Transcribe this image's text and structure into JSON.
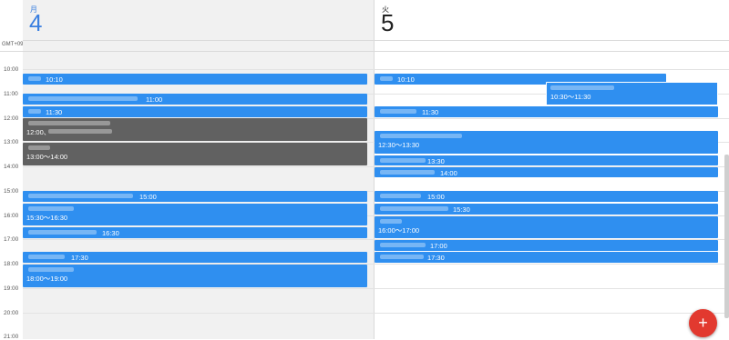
{
  "timezone": "GMT+09",
  "days": [
    {
      "dow": "月",
      "date": "4"
    },
    {
      "dow": "火",
      "date": "5"
    }
  ],
  "hours": [
    "10:00",
    "11:00",
    "12:00",
    "13:00",
    "14:00",
    "15:00",
    "16:00",
    "17:00",
    "18:00",
    "19:00",
    "20:00",
    "21:00"
  ],
  "monday_events": [
    {
      "time": "10:10"
    },
    {
      "time": "11:00"
    },
    {
      "time": "11:30"
    },
    {
      "time": "12:00、"
    },
    {
      "time": "13:00～14:00"
    },
    {
      "time": "15:00"
    },
    {
      "time": "15:30～16:30"
    },
    {
      "time": "16:30"
    },
    {
      "time": "17:30"
    },
    {
      "time": "18:00～19:00"
    }
  ],
  "tuesday_events": [
    {
      "time": "10:10"
    },
    {
      "time": "10:30～11:30"
    },
    {
      "time": "11:30"
    },
    {
      "time": "12:30～13:30"
    },
    {
      "time": "13:30"
    },
    {
      "time": "14:00"
    },
    {
      "time": "15:00"
    },
    {
      "time": "15:30"
    },
    {
      "time": "16:00～17:00"
    },
    {
      "time": "17:00"
    },
    {
      "time": "17:30"
    }
  ],
  "fab_icon": "+",
  "colors": {
    "event": "#2f8ff0",
    "event_dark": "#616161",
    "accent": "#3a7fe0",
    "fab": "#e2392f"
  }
}
